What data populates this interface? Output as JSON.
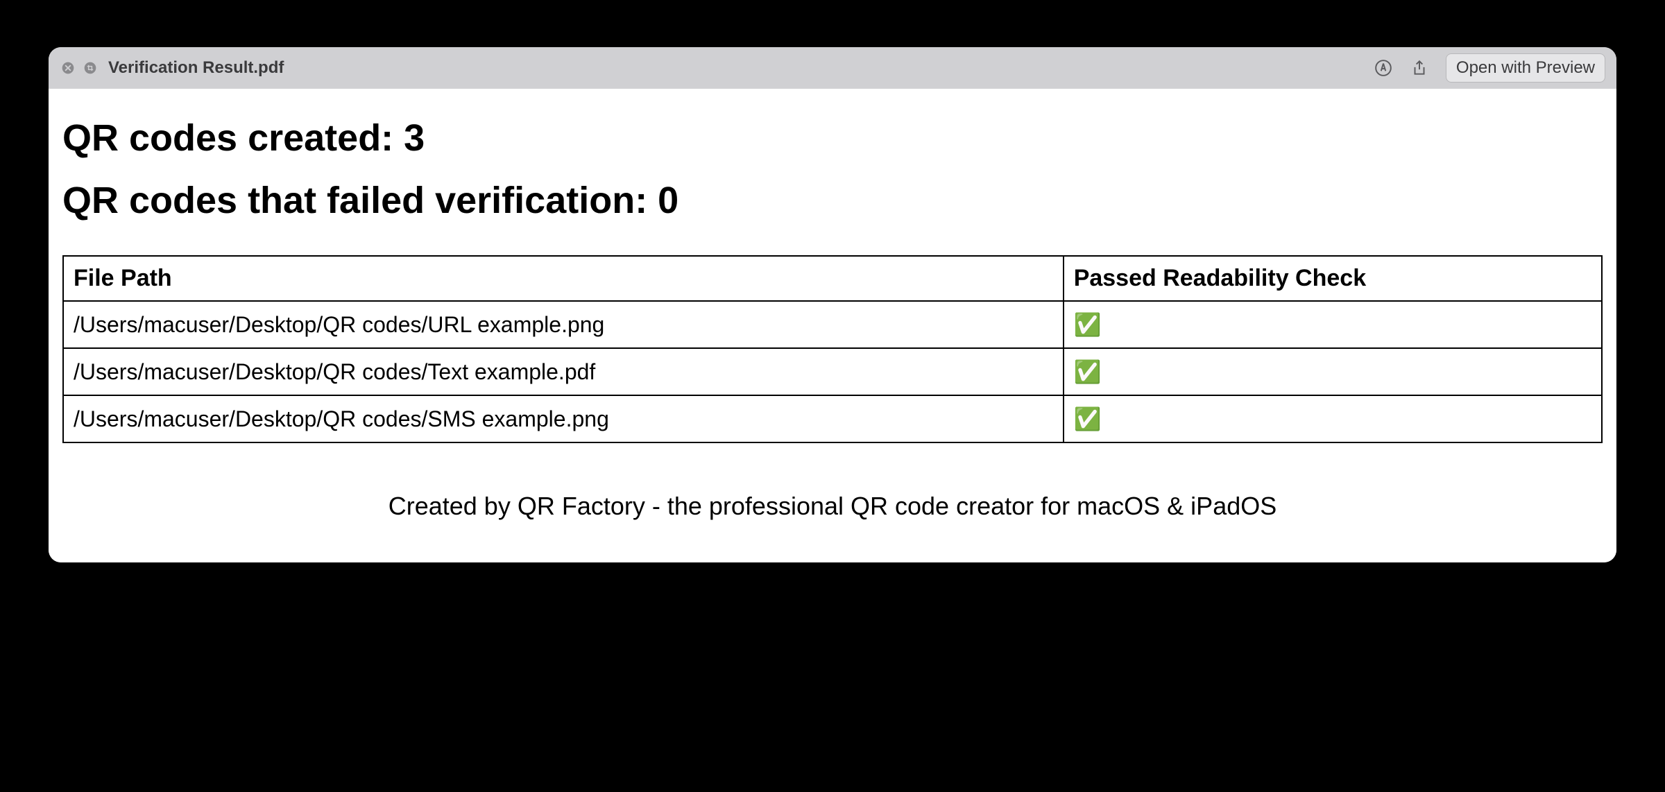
{
  "titlebar": {
    "title": "Verification Result.pdf",
    "open_button": "Open with Preview"
  },
  "document": {
    "heading_created": "QR codes created: 3",
    "heading_failed": "QR codes that failed verification: 0",
    "table": {
      "headers": {
        "file_path": "File Path",
        "passed": "Passed Readability Check"
      },
      "rows": [
        {
          "path": "/Users/macuser/Desktop/QR codes/URL example.png",
          "passed": "✅"
        },
        {
          "path": "/Users/macuser/Desktop/QR codes/Text example.pdf",
          "passed": "✅"
        },
        {
          "path": "/Users/macuser/Desktop/QR codes/SMS example.png",
          "passed": "✅"
        }
      ]
    },
    "footer": "Created by QR Factory - the professional QR code creator for macOS & iPadOS"
  }
}
